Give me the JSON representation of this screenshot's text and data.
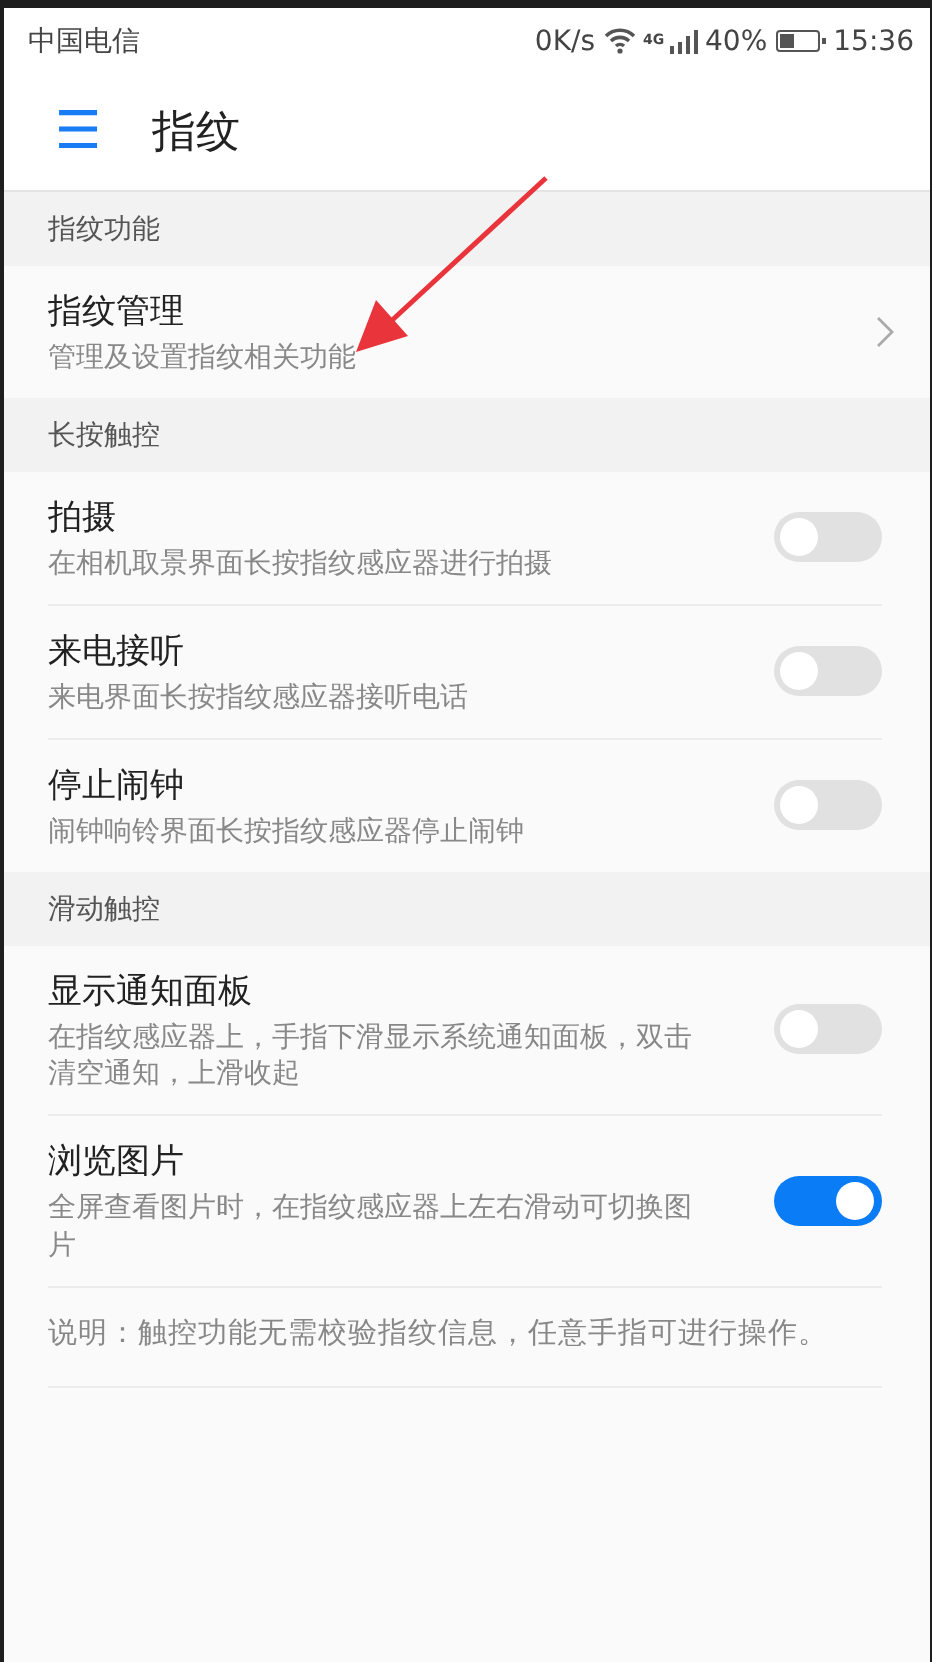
{
  "status_bar": {
    "carrier": "中国电信",
    "speed": "0K/s",
    "network": "4G",
    "battery": "40%",
    "time": "15:36"
  },
  "header": {
    "menu_icon": "☰",
    "title": "指纹"
  },
  "sections": [
    {
      "title": "指纹功能",
      "items": [
        {
          "kind": "link",
          "title": "指纹管理",
          "subtitle": "管理及设置指纹相关功能"
        }
      ]
    },
    {
      "title": "长按触控",
      "items": [
        {
          "kind": "switch",
          "title": "拍摄",
          "subtitle": "在相机取景界面长按指纹感应器进行拍摄",
          "on": false
        },
        {
          "kind": "switch",
          "title": "来电接听",
          "subtitle": "来电界面长按指纹感应器接听电话",
          "on": false
        },
        {
          "kind": "switch",
          "title": "停止闹钟",
          "subtitle": "闹钟响铃界面长按指纹感应器停止闹钟",
          "on": false
        }
      ]
    },
    {
      "title": "滑动触控",
      "items": [
        {
          "kind": "switch",
          "title": "显示通知面板",
          "subtitle": "在指纹感应器上，手指下滑显示系统通知面板，双击清空通知，上滑收起",
          "on": false
        },
        {
          "kind": "switch",
          "title": "浏览图片",
          "subtitle": "全屏查看图片时，在指纹感应器上左右滑动可切换图片",
          "on": true
        }
      ]
    }
  ],
  "note": "说明：触控功能无需校验指纹信息，任意手指可进行操作。",
  "annotations": [
    {
      "kind": "arrow"
    }
  ]
}
